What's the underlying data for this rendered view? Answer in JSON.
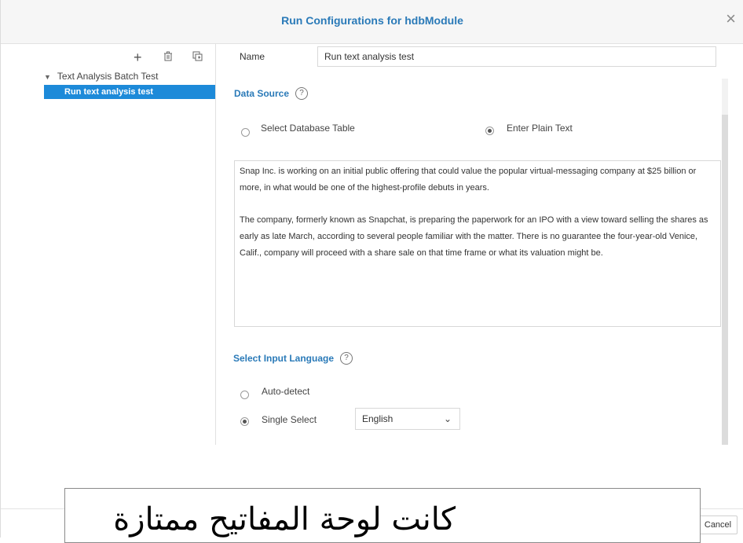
{
  "dialog": {
    "title": "Run Configurations for hdbModule",
    "close_icon": "×"
  },
  "toolbar": {
    "add_icon": "+",
    "delete_icon": "🗑",
    "copy_icon": "⧉"
  },
  "tree": {
    "parent_caret": "▼",
    "parent_label": "Text Analysis Batch Test",
    "child_label": "Run text analysis test"
  },
  "form": {
    "name_label": "Name",
    "name_value": "Run text analysis test",
    "data_source": {
      "title": "Data Source",
      "help": "?",
      "option_table": "Select Database Table",
      "option_plain": "Enter Plain Text",
      "selected": "Enter Plain Text"
    },
    "text_paragraphs": [
      "Snap Inc. is working on an initial public offering that could value the popular virtual-messaging company at $25 billion or more, in what would be one of the highest-profile debuts in years.",
      "The company, formerly known as Snapchat, is preparing the paperwork for an IPO with a view toward selling the shares as early as late March, according to several people familiar with the matter. There is no guarantee the four-year-old Venice, Calif., company will proceed with a share sale on that time frame or what its valuation might be."
    ],
    "language": {
      "title": "Select Input Language",
      "help": "?",
      "option_auto": "Auto-detect",
      "option_single": "Single Select",
      "selected": "Single Select",
      "dropdown_value": "English",
      "dropdown_icon": "⌄"
    }
  },
  "footer": {
    "cancel_label": "Cancel"
  },
  "overlay": {
    "text": "كانت لوحة المفاتيح ممتازة"
  }
}
